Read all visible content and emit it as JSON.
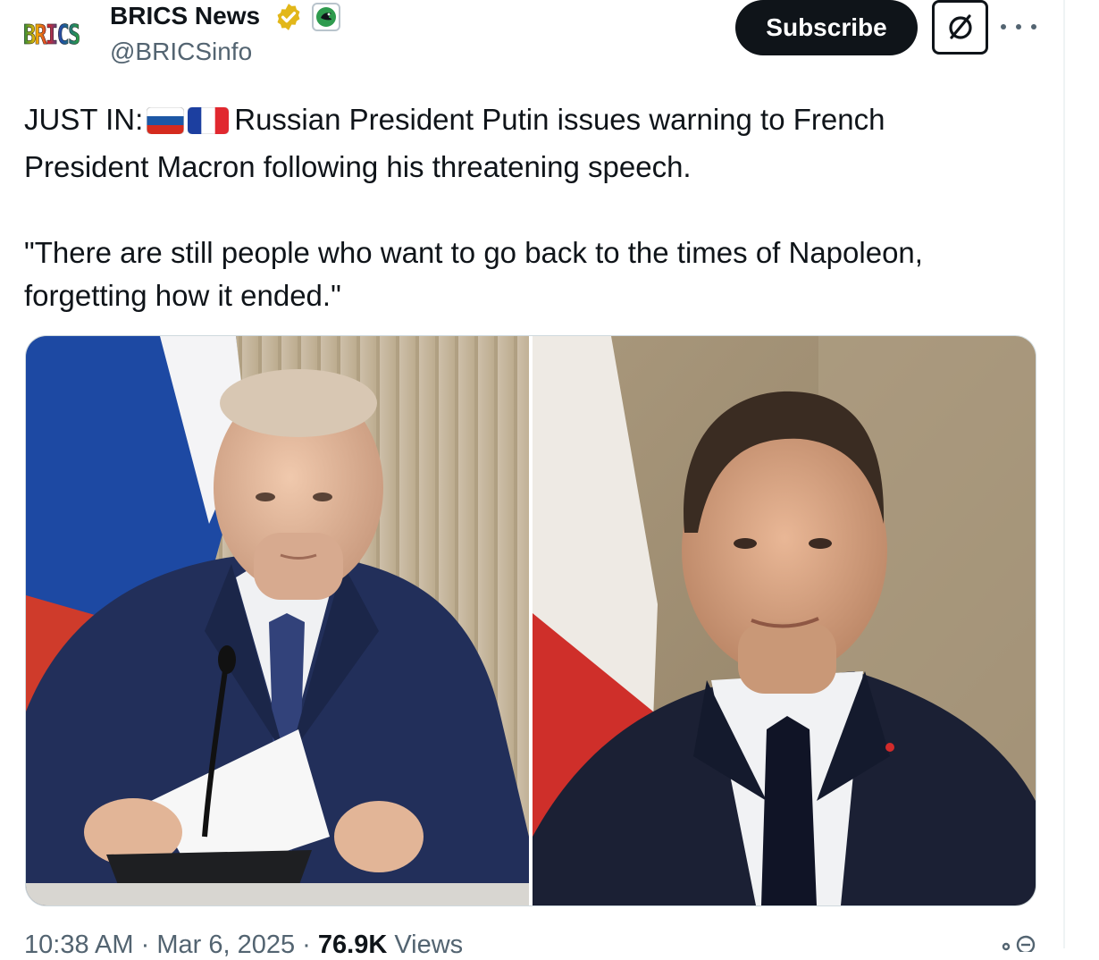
{
  "header": {
    "avatar_text": "BRICS",
    "display_name": "BRICS News",
    "handle": "@BRICSinfo",
    "subscribe_label": "Subscribe",
    "icons": {
      "verified": "gold-verified-badge-icon",
      "affiliate": "affiliate-badge-icon",
      "grok": "grok-icon",
      "more": "more-options-icon"
    }
  },
  "tweet": {
    "line1_prefix": "JUST IN:",
    "line1_rest": "Russian President Putin issues warning to French",
    "line2": "President Macron following his threatening speech.",
    "line3": "\"There are still people who want to go back to the times of Napoleon,",
    "line4": "forgetting how it ended.\"",
    "flags": [
      "russia-flag",
      "france-flag"
    ]
  },
  "media": {
    "left_photo": "Vladimir Putin at desk with microphone",
    "right_photo": "Emmanuel Macron in front of French flag"
  },
  "footer": {
    "time": "10:38 AM",
    "separator": "·",
    "date": "Mar 6, 2025",
    "views_count": "76.9K",
    "views_label": "Views"
  },
  "colors": {
    "text": "#0f1419",
    "secondary": "#536471",
    "button": "#0f1419",
    "border": "#cfd9de"
  }
}
